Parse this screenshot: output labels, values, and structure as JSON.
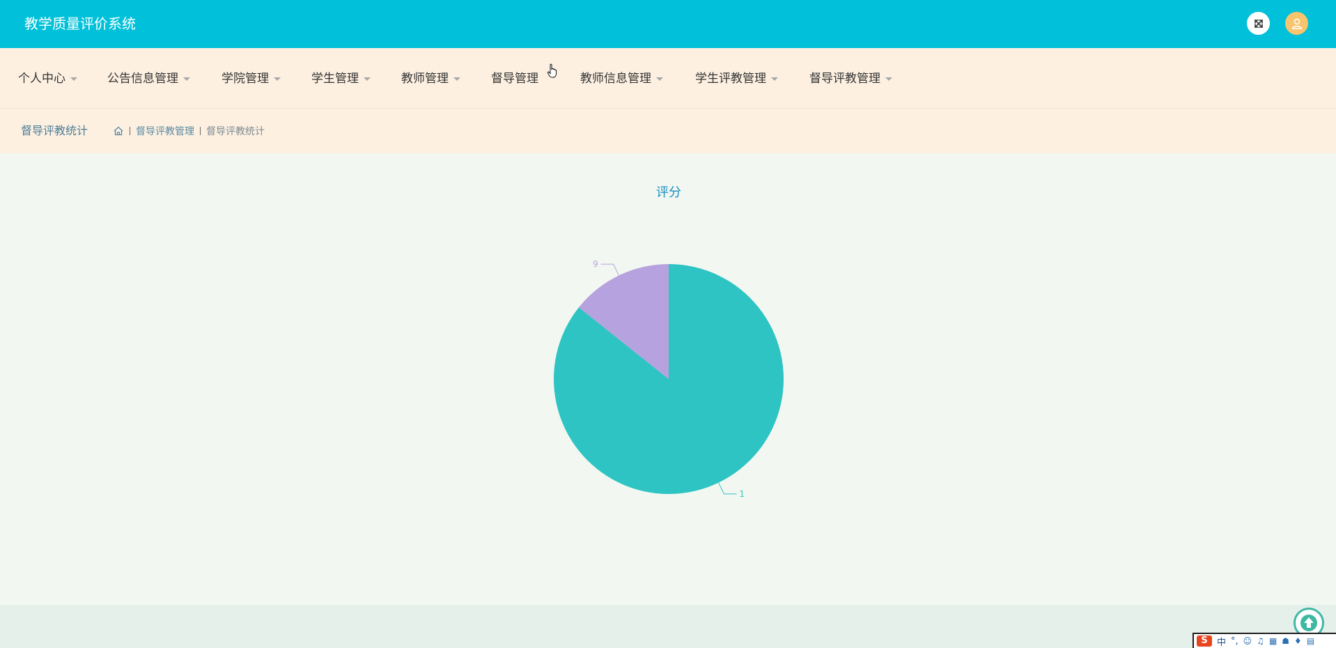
{
  "header": {
    "app_title": "教学质量评价系统",
    "icons": [
      "fullscreen-icon",
      "user-icon"
    ]
  },
  "nav": {
    "items": [
      {
        "label": "个人中心",
        "has_dropdown": true
      },
      {
        "label": "公告信息管理",
        "has_dropdown": true
      },
      {
        "label": "学院管理",
        "has_dropdown": true
      },
      {
        "label": "学生管理",
        "has_dropdown": true
      },
      {
        "label": "教师管理",
        "has_dropdown": true
      },
      {
        "label": "督导管理",
        "has_dropdown": false
      },
      {
        "label": "教师信息管理",
        "has_dropdown": true
      },
      {
        "label": "学生评教管理",
        "has_dropdown": true
      },
      {
        "label": "督导评教管理",
        "has_dropdown": true
      }
    ]
  },
  "breadcrumb": {
    "page_title": "督导评教统计",
    "home_icon": "home-icon",
    "items": [
      "督导评教管理",
      "督导评教统计"
    ]
  },
  "chart_data": {
    "type": "pie",
    "title": "评分",
    "slices": [
      {
        "label": "1",
        "value": 6,
        "color": "#2ec4c3"
      },
      {
        "label": "9",
        "value": 1,
        "color": "#b6a2de"
      }
    ]
  },
  "colors": {
    "header_bg": "#00c1d9",
    "nav_bg": "#fdf0e1",
    "content_bg": "#f2f7f1",
    "title_color": "#1b8fc1"
  },
  "ime": {
    "logo": "S",
    "mode": "中",
    "punct": "°,"
  }
}
